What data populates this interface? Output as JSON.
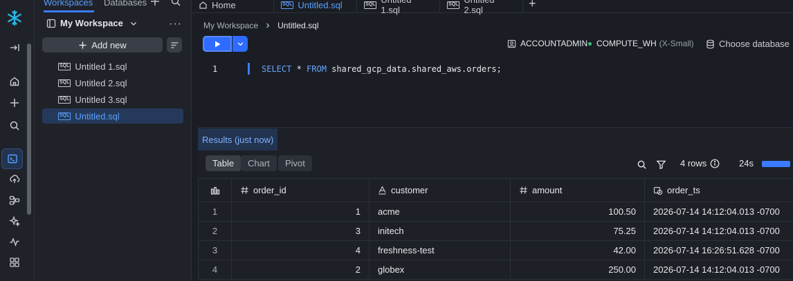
{
  "panel": {
    "tabs": [
      "Workspaces",
      "Databases"
    ],
    "workspace_title": "My Workspace",
    "more_label": "···",
    "add_new_label": "Add new",
    "files": [
      "Untitled 1.sql",
      "Untitled 2.sql",
      "Untitled 3.sql",
      "Untitled.sql"
    ],
    "active_file_index": 3
  },
  "tabbar": {
    "tabs": [
      "Home",
      "Untitled.sql",
      "Untitled 1.sql",
      "Untitled 2.sql"
    ],
    "active_index": 1
  },
  "editor": {
    "breadcrumb": [
      "My Workspace",
      "Untitled.sql"
    ],
    "role": "ACCOUNTADMIN",
    "warehouse": "COMPUTE_WH",
    "warehouse_size": "(X-Small)",
    "database_placeholder": "Choose database",
    "line_number": "1",
    "code_keyword1": "SELECT",
    "code_star": " * ",
    "code_keyword2": "FROM",
    "code_rest": " shared_gcp_data.shared_aws.orders;"
  },
  "results": {
    "title": "Results (just now)",
    "views": [
      "Table",
      "Chart",
      "Pivot"
    ],
    "rows_label": "4 rows",
    "duration": "24s",
    "columns": [
      "order_id",
      "customer",
      "amount",
      "order_ts"
    ],
    "rows": [
      {
        "idx": "1",
        "order_id": "1",
        "customer": "acme",
        "amount": "100.50",
        "order_ts": "2026-07-14 14:12:04.013 -0700"
      },
      {
        "idx": "2",
        "order_id": "3",
        "customer": "initech",
        "amount": "75.25",
        "order_ts": "2026-07-14 14:12:04.013 -0700"
      },
      {
        "idx": "3",
        "order_id": "4",
        "customer": "freshness-test",
        "amount": "42.00",
        "order_ts": "2026-07-14 16:26:51.628 -0700"
      },
      {
        "idx": "4",
        "order_id": "2",
        "customer": "globex",
        "amount": "250.00",
        "order_ts": "2026-07-14 14:12:04.013 -0700"
      }
    ]
  },
  "colors": {
    "accent": "#3b7bff",
    "background": "#1a1d23",
    "panel": "#1f2228",
    "warehouse_status": "#33c27a"
  }
}
